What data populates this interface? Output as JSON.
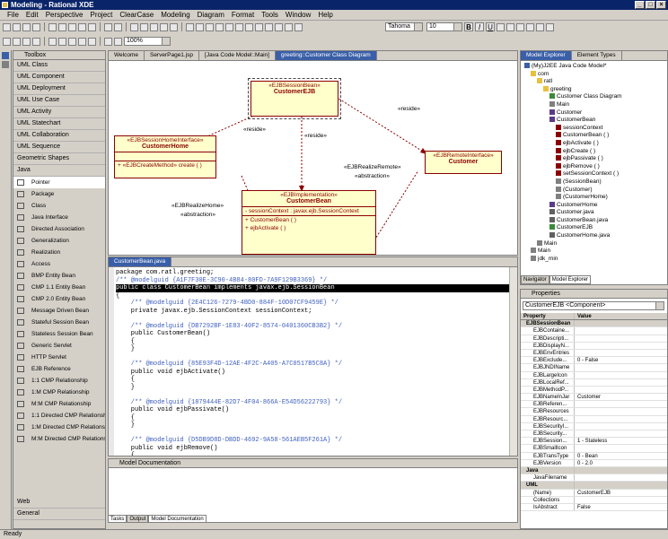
{
  "window": {
    "title": "Modeling - Rational XDE"
  },
  "menu": [
    "File",
    "Edit",
    "Perspective",
    "Project",
    "ClearCase",
    "Modeling",
    "Diagram",
    "Format",
    "Tools",
    "Window",
    "Help"
  ],
  "toolbar": {
    "font": "Tahoma",
    "font_size": "10",
    "zoom": "100%",
    "bold": "B",
    "italic": "I",
    "underline": "U"
  },
  "toolbox": {
    "title": "Toolbox",
    "categories": [
      "UML Class",
      "UML Component",
      "UML Deployment",
      "UML Use Case",
      "UML Activity",
      "UML Statechart",
      "UML Collaboration",
      "UML Sequence",
      "Geometric Shapes",
      "Java"
    ],
    "tools": [
      "Pointer",
      "Package",
      "Class",
      "Java Interface",
      "Directed Association",
      "Generalization",
      "Realization",
      "Access",
      "BMP Entity Bean",
      "CMP 1.1 Entity Bean",
      "CMP 2.0 Entity Bean",
      "Message Driven Bean",
      "Stateful Session Bean",
      "Stateless Session Bean",
      "Generic Servlet",
      "HTTP Servlet",
      "EJB Reference",
      "1:1 CMP Relationship",
      "1:M CMP Relationship",
      "M:M CMP Relationship",
      "1:1 Directed CMP Relationship",
      "1:M Directed CMP Relationship",
      "M:M Directed CMP Relations..."
    ],
    "bottom": [
      "Web",
      "General"
    ]
  },
  "editor_tabs": [
    "Welcome",
    "ServerPage1.jsp",
    "[Java Code Model::Main]",
    "greeting::Customer Class Diagram"
  ],
  "diagram": {
    "session_bean": {
      "stereo": "«EJBSessionBean»",
      "name": "CustomerEJB"
    },
    "home": {
      "stereo": "«EJBSessionHomeInterface»",
      "name": "CustomerHome",
      "ops": [
        "+ «EJBCreateMethod» create ( )"
      ]
    },
    "remote": {
      "stereo": "«EJBRemoteInterface»",
      "name": "Customer"
    },
    "impl": {
      "stereo": "«EJBImplementation»",
      "name": "CustomerBean",
      "attrs": [
        "- sessionContext : javax.ejb.SessionContext"
      ],
      "ops": [
        "+ CustomerBean ( )",
        "+ ejbActivate ( )"
      ]
    },
    "labels": {
      "reside1": "«reside»",
      "reside2": "«reside»",
      "reside3": "«reside»",
      "realize_home": "«EJBRealizeHome»",
      "abstraction1": "«abstraction»",
      "realize_remote": "«EJBRealizeRemote»",
      "abstraction2": "«abstraction»"
    }
  },
  "code_tab": "CustomerBean.java",
  "code_lines": [
    "package com.ratl.greeting;",
    "/** @modelguid {A1F7F30E-3C90-4B84-80FD-7A9F129B3369} */",
    "public class CustomerBean implements javax.ejb.SessionBean",
    "{",
    "    /** @modelguid {2E4C126-7279-4BD0-884F-10D07CF9459E} */",
    "    private javax.ejb.SessionContext sessionContext;",
    "",
    "    /** @modelguid {DB7292BF-1E83-40F2-8574-0401360CB3B2} */",
    "    public CustomerBean()",
    "    {",
    "    }",
    "",
    "    /** @modelguid {85E93F4D-12AE-4F2C-A405-A7C0517B5C8A} */",
    "    public void ejbActivate()",
    "    {",
    "    }",
    "",
    "    /** @modelguid {1879444E-82D7-4F04-866A-E54D56222793} */",
    "    public void ejbPassivate()",
    "    {",
    "    }",
    "",
    "    /** @modelguid {D5DB9D8D-DBDD-4692-9A58-561AEB5F261A} */",
    "    public void ejbRemove()",
    "    {",
    "    }"
  ],
  "doc": {
    "title": "Model Documentation",
    "tabs": [
      "Tasks",
      "Output",
      "Model Documentation"
    ]
  },
  "explorer": {
    "tabs": [
      "Model Explorer",
      "Element Types"
    ],
    "bottom_tabs": [
      "Navigator",
      "Model Explorer"
    ],
    "tree": [
      "(My)J2EE Java Code Model*",
      "com",
      "ratl",
      "greeting",
      "Customer Class Diagram",
      "Main",
      "Customer",
      "CustomerBean",
      "sessionContext",
      "CustomerBean ( )",
      "ejbActivate ( )",
      "ejbCreate ( )",
      "ejbPassivate ( )",
      "ejbRemove ( )",
      "setSessionContext ( )",
      "(SessionBean)",
      "(Customer)",
      "(CustomerHome)",
      "CustomerHome",
      "Customer.java",
      "CustomerBean.java",
      "CustomerEJB",
      "CustomerHome.java",
      "Main",
      "Main",
      "jdk_min"
    ]
  },
  "properties": {
    "title": "Properties",
    "selector": "CustomerEJB <Component>",
    "headers": [
      "Property",
      "Value"
    ],
    "rows": [
      {
        "k": "EJBSessionBean",
        "v": "",
        "cat": true
      },
      {
        "k": "EJBContaine...",
        "v": ""
      },
      {
        "k": "EJBDescripti...",
        "v": ""
      },
      {
        "k": "EJBDisplayN...",
        "v": ""
      },
      {
        "k": "EJBEnvEntries",
        "v": ""
      },
      {
        "k": "EJBExclude...",
        "v": "0 - False"
      },
      {
        "k": "EJBJNDIName",
        "v": ""
      },
      {
        "k": "EJBLargeIcon",
        "v": ""
      },
      {
        "k": "EJBLocalRef...",
        "v": ""
      },
      {
        "k": "EJBMethodP...",
        "v": ""
      },
      {
        "k": "EJBNameInJar",
        "v": "Customer"
      },
      {
        "k": "EJBReferen...",
        "v": ""
      },
      {
        "k": "EJBResources",
        "v": ""
      },
      {
        "k": "EJBResourc...",
        "v": ""
      },
      {
        "k": "EJBSecurityI...",
        "v": ""
      },
      {
        "k": "EJBSecurity...",
        "v": ""
      },
      {
        "k": "EJBSession...",
        "v": "1 - Stateless"
      },
      {
        "k": "EJBSmallIcon",
        "v": ""
      },
      {
        "k": "EJBTransType",
        "v": "0 - Bean"
      },
      {
        "k": "EJBVersion",
        "v": "0 - 2.0"
      },
      {
        "k": "Java",
        "v": "",
        "cat": true
      },
      {
        "k": "JavaFilename",
        "v": ""
      },
      {
        "k": "UML",
        "v": "",
        "cat": true
      },
      {
        "k": "(Name)",
        "v": "CustomerEJB"
      },
      {
        "k": "Collections",
        "v": ""
      },
      {
        "k": "IsAbstract",
        "v": "False"
      }
    ]
  },
  "status": "Ready"
}
